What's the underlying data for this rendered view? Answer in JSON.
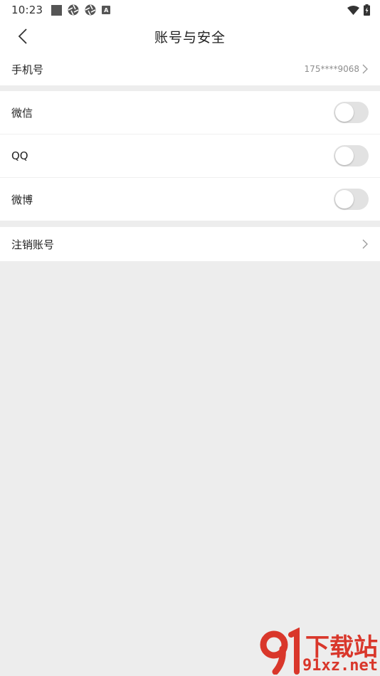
{
  "status_bar": {
    "time": "10:23",
    "notification_icons": [
      "square-icon",
      "aperture-icon",
      "aperture-icon",
      "a-badge-icon"
    ],
    "a_badge": "A",
    "right_icons": [
      "wifi-icon",
      "battery-charging-icon"
    ]
  },
  "header": {
    "back_icon": "chevron-left-icon",
    "title": "账号与安全"
  },
  "phone": {
    "label": "手机号",
    "value": "175****9068"
  },
  "bindings": [
    {
      "label": "微信",
      "enabled": false
    },
    {
      "label": "QQ",
      "enabled": false
    },
    {
      "label": "微博",
      "enabled": false
    }
  ],
  "deactivate": {
    "label": "注销账号"
  },
  "watermark": {
    "line1": "下载站",
    "line2": "91xz.net"
  },
  "colors": {
    "background": "#ededed",
    "toggle_off": "#e2e2e2",
    "watermark": "#d9372b",
    "value_gray": "#8e8e8e"
  }
}
